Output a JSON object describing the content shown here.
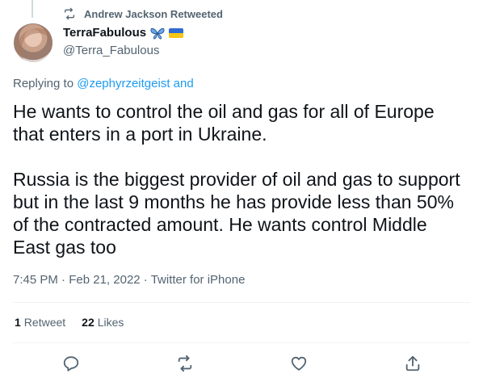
{
  "retweet_context": {
    "icon": "retweet-icon",
    "text": "Andrew Jackson Retweeted"
  },
  "author": {
    "display_name": "TerraFabulous",
    "badges": [
      "butterfly-icon",
      "ukraine-flag-icon"
    ],
    "handle": "@Terra_Fabulous"
  },
  "replying": {
    "prefix": "Replying to ",
    "mention": "@zephyrzeitgeist and"
  },
  "tweet": {
    "text": "He wants to control the oil and gas for all of Europe\nthat enters in a port in Ukraine.\n\nRussia is the biggest provider of oil and gas to support\nbut in the last 9 months he has provide less than 50%\nof the contracted amount. He wants control Middle\nEast gas too"
  },
  "meta": {
    "time": "7:45 PM",
    "sep1": " · ",
    "date": "Feb 21, 2022",
    "sep2": " · ",
    "client": "Twitter for iPhone"
  },
  "stats": {
    "retweets": "1",
    "retweets_label": "Retweet",
    "likes": "22",
    "likes_label": "Likes"
  },
  "actions": [
    {
      "name": "reply",
      "icon": "reply-icon"
    },
    {
      "name": "retweet",
      "icon": "retweet-icon"
    },
    {
      "name": "like",
      "icon": "heart-icon"
    },
    {
      "name": "share",
      "icon": "share-icon"
    }
  ],
  "colors": {
    "text": "#0f1419",
    "secondary": "#536471",
    "link": "#1d9bf0",
    "divider": "#eff3f4"
  }
}
